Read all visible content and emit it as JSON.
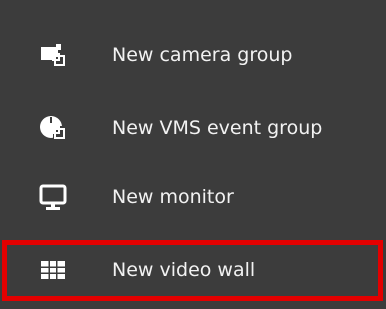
{
  "menu": {
    "items": [
      {
        "label": "New camera group",
        "icon": "camera-group-icon"
      },
      {
        "label": "New VMS event group",
        "icon": "vms-event-group-icon"
      },
      {
        "label": "New monitor",
        "icon": "monitor-icon"
      },
      {
        "label": "New video wall",
        "icon": "video-wall-icon",
        "highlighted": true
      }
    ]
  },
  "colors": {
    "panel_background": "#3c3c3c",
    "text": "#f2f2f2",
    "icon": "#ffffff",
    "highlight": "#e30000"
  }
}
